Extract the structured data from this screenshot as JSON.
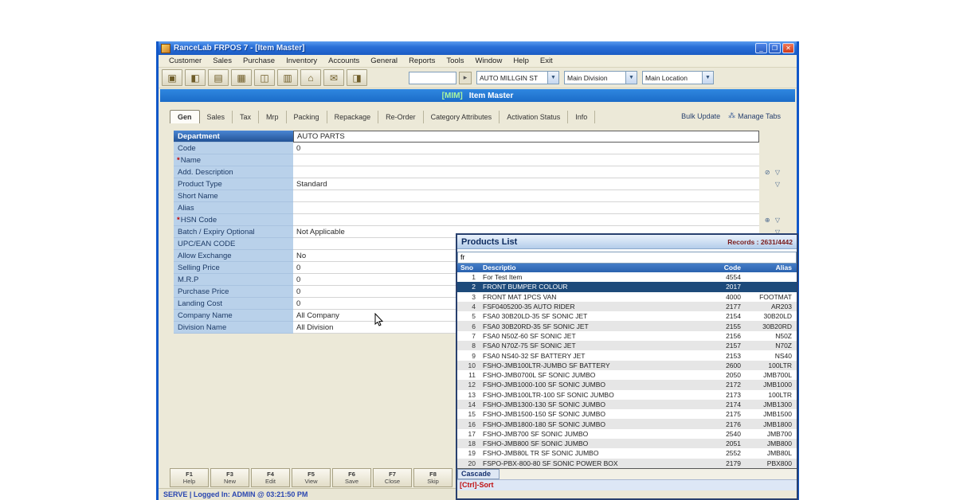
{
  "window": {
    "title": "RanceLab FRPOS 7 - [Item Master]",
    "controls": {
      "minimize": "_",
      "restore": "❐",
      "close": "✕"
    }
  },
  "menu": {
    "items": [
      {
        "label": "Customer"
      },
      {
        "label": "Sales"
      },
      {
        "label": "Purchase"
      },
      {
        "label": "Inventory"
      },
      {
        "label": "Accounts"
      },
      {
        "label": "General"
      },
      {
        "label": "Reports"
      },
      {
        "label": "Tools"
      },
      {
        "label": "Window"
      },
      {
        "label": "Help"
      },
      {
        "label": "Exit"
      }
    ]
  },
  "toolbar": {
    "icons": [
      {
        "name": "customer-icon",
        "glyph": "▣"
      },
      {
        "name": "sales-icon",
        "glyph": "◧"
      },
      {
        "name": "purchase-icon",
        "glyph": "▤"
      },
      {
        "name": "inventory-icon",
        "glyph": "▦"
      },
      {
        "name": "accounts-icon",
        "glyph": "◫"
      },
      {
        "name": "reports-icon",
        "glyph": "▥"
      },
      {
        "name": "home-icon",
        "glyph": "⌂"
      },
      {
        "name": "mail-icon",
        "glyph": "✉"
      },
      {
        "name": "print-icon",
        "glyph": "◨"
      }
    ],
    "search_value": "",
    "go_glyph": "▸",
    "company_select": "AUTO MILLGIN ST",
    "division_select": "Main Division",
    "location_select": "Main Location",
    "dropdown_glyph": "▼"
  },
  "header": {
    "code": "[MIM]",
    "title": "Item Master"
  },
  "tabs": {
    "items": [
      {
        "label": "Gen"
      },
      {
        "label": "Sales"
      },
      {
        "label": "Tax"
      },
      {
        "label": "Mrp"
      },
      {
        "label": "Packing"
      },
      {
        "label": "Repackage"
      },
      {
        "label": "Re-Order"
      },
      {
        "label": "Category Attributes"
      },
      {
        "label": "Activation Status"
      },
      {
        "label": "Info"
      }
    ],
    "bulk_update": "Bulk Update",
    "manage_tabs": "Manage Tabs",
    "manage_tabs_glyph": "⁂"
  },
  "form": {
    "selected_index": 0,
    "rows": [
      {
        "req": "",
        "label": "Department",
        "value": "AUTO PARTS",
        "icons": ""
      },
      {
        "req": "",
        "label": "Code",
        "value": "0",
        "icons": ""
      },
      {
        "req": "*",
        "label": "Name",
        "value": "",
        "icons": ""
      },
      {
        "req": "",
        "label": "Add. Description",
        "value": "",
        "icons": "⊘ ▽"
      },
      {
        "req": "",
        "label": "Product Type",
        "value": "Standard",
        "icons": "▽"
      },
      {
        "req": "",
        "label": "Short Name",
        "value": "",
        "icons": ""
      },
      {
        "req": "",
        "label": "Alias",
        "value": "",
        "icons": ""
      },
      {
        "req": "*",
        "label": "HSN Code",
        "value": "",
        "icons": "⊕ ▽"
      },
      {
        "req": "",
        "label": "Batch / Expiry Optional",
        "value": "Not Applicable",
        "icons": "▽"
      },
      {
        "req": "",
        "label": "UPC/EAN CODE",
        "value": "",
        "icons": ""
      },
      {
        "req": "",
        "label": "Allow Exchange",
        "value": "No",
        "icons": ""
      },
      {
        "req": "",
        "label": "Selling Price",
        "value": "0",
        "icons": ""
      },
      {
        "req": "",
        "label": "M.R.P",
        "value": "0",
        "icons": ""
      },
      {
        "req": "",
        "label": "Purchase Price",
        "value": "0",
        "icons": ""
      },
      {
        "req": "",
        "label": "Landing Cost",
        "value": "0",
        "icons": ""
      },
      {
        "req": "",
        "label": "Company Name",
        "value": "All Company",
        "icons": ""
      },
      {
        "req": "",
        "label": "Division Name",
        "value": "All Division",
        "icons": ""
      }
    ]
  },
  "popup": {
    "title": "Products List",
    "records": "Records : 2631/4442",
    "filter_value": "fr",
    "columns": {
      "sno": "Sno",
      "desc": "Descriptio",
      "code": "Code",
      "alias": "Alias"
    },
    "selected_index": 1,
    "rows": [
      {
        "sno": "1",
        "desc": "For Test Item",
        "code": "4554",
        "alias": ""
      },
      {
        "sno": "2",
        "desc": "FRONT BUMPER COLOUR",
        "code": "2017",
        "alias": ""
      },
      {
        "sno": "3",
        "desc": "FRONT MAT 1PCS VAN",
        "code": "4000",
        "alias": "FOOTMAT"
      },
      {
        "sno": "4",
        "desc": "FSF0405200-35 AUTO RIDER",
        "code": "2177",
        "alias": "AR203"
      },
      {
        "sno": "5",
        "desc": "FSA0 30B20LD-35 SF SONIC JET",
        "code": "2154",
        "alias": "30B20LD"
      },
      {
        "sno": "6",
        "desc": "FSA0 30B20RD-35 SF SONIC JET",
        "code": "2155",
        "alias": "30B20RD"
      },
      {
        "sno": "7",
        "desc": "FSA0 N50Z-60 SF SONIC JET",
        "code": "2156",
        "alias": "N50Z"
      },
      {
        "sno": "8",
        "desc": "FSA0 N70Z-75 SF SONIC JET",
        "code": "2157",
        "alias": "N70Z"
      },
      {
        "sno": "9",
        "desc": "FSA0 NS40-32 SF BATTERY JET",
        "code": "2153",
        "alias": "NS40"
      },
      {
        "sno": "10",
        "desc": "FSHO-JMB100LTR-JUMBO SF BATTERY",
        "code": "2600",
        "alias": "100LTR"
      },
      {
        "sno": "11",
        "desc": "FSHO-JMB0700L SF SONIC JUMBO",
        "code": "2050",
        "alias": "JMB700L"
      },
      {
        "sno": "12",
        "desc": "FSHO-JMB1000-100 SF SONIC JUMBO",
        "code": "2172",
        "alias": "JMB1000"
      },
      {
        "sno": "13",
        "desc": "FSHO-JMB100LTR-100 SF SONIC JUMBO",
        "code": "2173",
        "alias": "100LTR"
      },
      {
        "sno": "14",
        "desc": "FSHO-JMB1300-130 SF SONIC JUMBO",
        "code": "2174",
        "alias": "JMB1300"
      },
      {
        "sno": "15",
        "desc": "FSHO-JMB1500-150 SF SONIC JUMBO",
        "code": "2175",
        "alias": "JMB1500"
      },
      {
        "sno": "16",
        "desc": "FSHO-JMB1800-180 SF SONIC JUMBO",
        "code": "2176",
        "alias": "JMB1800"
      },
      {
        "sno": "17",
        "desc": "FSHO-JMB700 SF SONIC JUMBO",
        "code": "2540",
        "alias": "JMB700"
      },
      {
        "sno": "18",
        "desc": "FSHO-JMB800 SF SONIC JUMBO",
        "code": "2051",
        "alias": "JMB800"
      },
      {
        "sno": "19",
        "desc": "FSHO-JMB80L TR SF SONIC JUMBO",
        "code": "2552",
        "alias": "JMB80L"
      },
      {
        "sno": "20",
        "desc": "FSPO-PBX-800-80 SF SONIC POWER BOX",
        "code": "2179",
        "alias": "PBX800"
      }
    ],
    "cascade": "Cascade",
    "sort_hint": "[Ctrl]-Sort"
  },
  "fkeys": {
    "items": [
      {
        "key": "F1",
        "label": "Help"
      },
      {
        "key": "F3",
        "label": "New"
      },
      {
        "key": "F4",
        "label": "Edit"
      },
      {
        "key": "F5",
        "label": "View"
      },
      {
        "key": "F6",
        "label": "Save"
      },
      {
        "key": "F7",
        "label": "Close"
      },
      {
        "key": "F8",
        "label": "Skip"
      }
    ]
  },
  "statusbar": {
    "text": "SERVE |  Logged In: ADMIN  @ 03:21:50 PM"
  }
}
